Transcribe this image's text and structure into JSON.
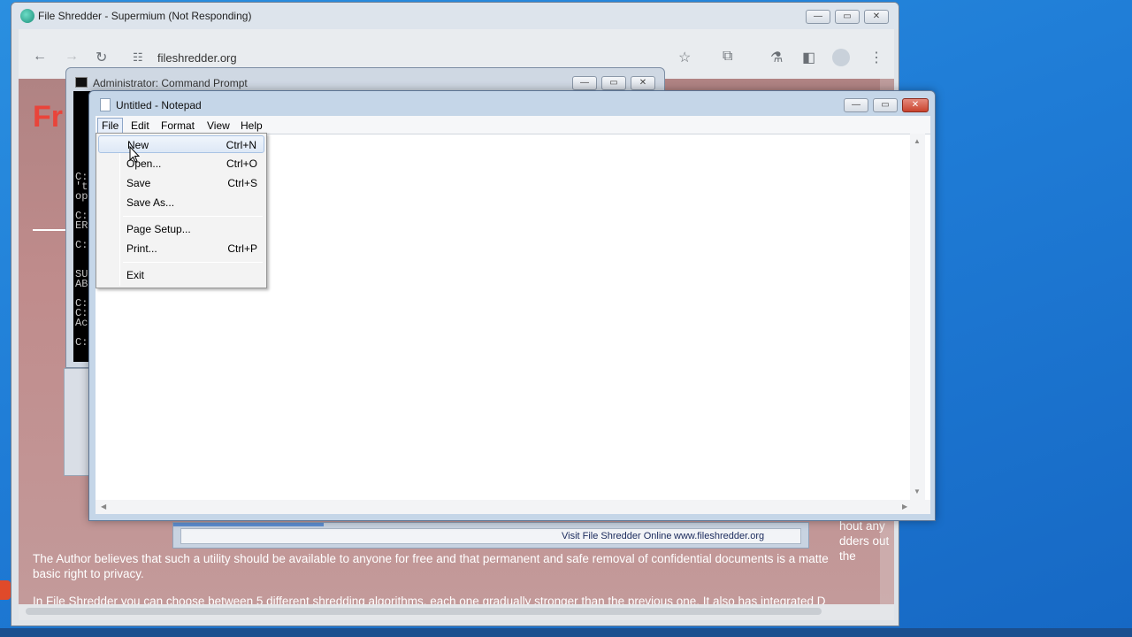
{
  "browser": {
    "title": "File Shredder - Supermium (Not Responding)",
    "url": "fileshredder.org",
    "page_heading_partial": "Fr",
    "paragraph1_line1": "The Author believes that such a utility should be available to anyone for free and that permanent and safe removal of confidential documents is a matte",
    "paragraph1_line2": "basic right to privacy.",
    "paragraph2_line1": "In File Shredder you can choose between 5 different shredding algorithms, each one gradually stronger than the previous one. It also has integrated D",
    "side_text_1": "hout any",
    "side_text_2": "dders out the",
    "window_buttons": [
      "minimize",
      "restore",
      "close"
    ]
  },
  "cmd": {
    "title": "Administrator:  Command Prompt",
    "lines": [
      "",
      "",
      "",
      "",
      "",
      "",
      "",
      "",
      "C:",
      "'t",
      "op",
      "",
      "C:",
      "ER",
      "",
      "C:",
      "",
      "",
      "SU",
      "AB",
      "",
      "C:",
      "C:",
      "Ac",
      "",
      "C:"
    ]
  },
  "notepad": {
    "title": "Untitled - Notepad",
    "menu": [
      "File",
      "Edit",
      "Format",
      "View",
      "Help"
    ]
  },
  "file_menu": {
    "items": [
      {
        "label": "New",
        "shortcut": "Ctrl+N"
      },
      {
        "label": "Open...",
        "shortcut": "Ctrl+O"
      },
      {
        "label": "Save",
        "shortcut": "Ctrl+S"
      },
      {
        "label": "Save As...",
        "shortcut": ""
      },
      {
        "label": "Page Setup...",
        "shortcut": ""
      },
      {
        "label": "Print...",
        "shortcut": "Ctrl+P"
      },
      {
        "label": "Exit",
        "shortcut": ""
      }
    ]
  },
  "shredder_bar": {
    "visit_label": "Visit File Shredder Online",
    "site": "www.fileshredder.org"
  },
  "colors": {
    "desktop": "#1f7cd6",
    "page_bg": "#c08c8c",
    "menu_hover": "#dde8f6"
  }
}
